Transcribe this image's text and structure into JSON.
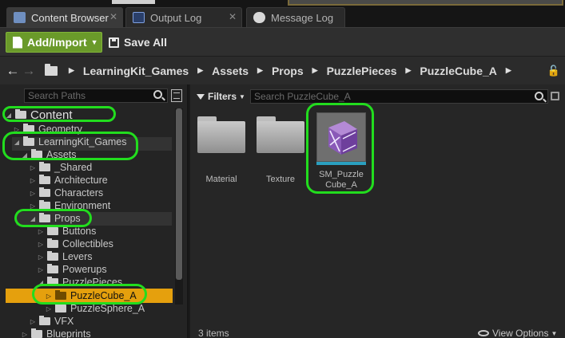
{
  "tabs": [
    {
      "label": "Content Browser",
      "icon": "content-browser-icon",
      "active": true
    },
    {
      "label": "Output Log",
      "icon": "output-log-icon",
      "active": false
    },
    {
      "label": "Message Log",
      "icon": "message-log-icon",
      "active": false
    }
  ],
  "toolbar": {
    "add_import_label": "Add/Import",
    "save_all_label": "Save All",
    "add_import_color": "#6a9a2a"
  },
  "breadcrumb": [
    "LearningKit_Games",
    "Assets",
    "Props",
    "PuzzlePieces",
    "PuzzleCube_A"
  ],
  "sources": {
    "search_placeholder": "Search Paths",
    "tree": [
      {
        "label": "Content",
        "level": 0,
        "expanded": true
      },
      {
        "label": "Geometry",
        "level": 1,
        "expanded": false
      },
      {
        "label": "LearningKit_Games",
        "level": 1,
        "expanded": true
      },
      {
        "label": "Assets",
        "level": 2,
        "expanded": true
      },
      {
        "label": "_Shared",
        "level": 3,
        "expanded": false
      },
      {
        "label": "Architecture",
        "level": 3,
        "expanded": false
      },
      {
        "label": "Characters",
        "level": 3,
        "expanded": false
      },
      {
        "label": "Environment",
        "level": 3,
        "expanded": false
      },
      {
        "label": "Props",
        "level": 3,
        "expanded": true
      },
      {
        "label": "Buttons",
        "level": 4,
        "expanded": false
      },
      {
        "label": "Collectibles",
        "level": 4,
        "expanded": false
      },
      {
        "label": "Levers",
        "level": 4,
        "expanded": false
      },
      {
        "label": "Powerups",
        "level": 4,
        "expanded": false
      },
      {
        "label": "PuzzlePieces",
        "level": 4,
        "expanded": true
      },
      {
        "label": "PuzzleCube_A",
        "level": 5,
        "expanded": false,
        "selected": true
      },
      {
        "label": "PuzzleSphere_A",
        "level": 5,
        "expanded": false
      },
      {
        "label": "VFX",
        "level": 3,
        "expanded": false
      },
      {
        "label": "Blueprints",
        "level": 2,
        "expanded": false
      }
    ],
    "selected_color": "#e5a00d"
  },
  "assets": {
    "filters_label": "Filters",
    "search_placeholder": "Search PuzzleCube_A",
    "items": [
      {
        "label": "Material",
        "kind": "folder"
      },
      {
        "label": "Texture",
        "kind": "folder"
      },
      {
        "label": "SM_Puzzle Cube_A",
        "kind": "static-mesh"
      }
    ],
    "item_count": "3 items",
    "view_options_label": "View Options"
  },
  "annotation_color": "#22dd1e"
}
